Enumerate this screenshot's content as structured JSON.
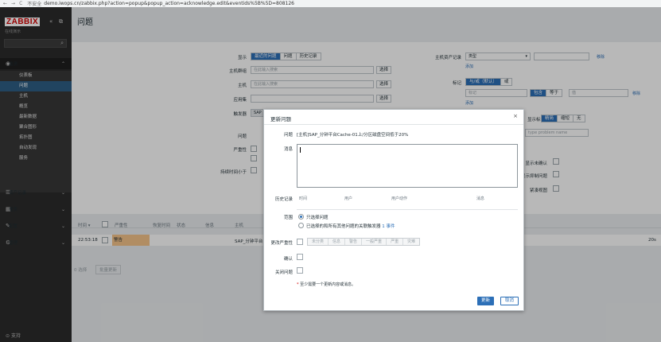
{
  "browser": {
    "back": "←",
    "forward": "→",
    "reload": "C",
    "security": "不安全",
    "url": "demo.iwops.cn/zabbix.php?action=popup&popup_action=acknowledge.edit&eventids%5B%5D=808126"
  },
  "sidebar": {
    "logo": "ZABBIX",
    "subtitle": "在线演示",
    "monitoring": "监测",
    "sub_items": [
      "仪表板",
      "问题",
      "主机",
      "概览",
      "最新数据",
      "聚合图形",
      "拓扑图",
      "自动发现",
      "服务"
    ],
    "inventory": "资产记录",
    "reports": "报表",
    "config": "配置",
    "admin": "管理",
    "support": "支持"
  },
  "page": {
    "title": "问题"
  },
  "filter": {
    "show": "显示",
    "show_opts": [
      "最近的问题",
      "问题",
      "历史记录"
    ],
    "host_groups": "主机群组",
    "host_groups_ph": "在此输入搜索",
    "hosts": "主机",
    "hosts_ph": "在此输入搜索",
    "application": "应用集",
    "triggers": "触发器",
    "triggers_val": "SAP",
    "problem": "问题",
    "severity": "严重性",
    "age_less": "持续时间小于",
    "select": "选择",
    "inventory": "主机资产记录",
    "inventory_val": "类型",
    "remove": "移除",
    "add": "添加",
    "tags": "标记",
    "tags_opts": [
      "与/或（默认）",
      "或"
    ],
    "tag_ph": "标记",
    "tag_op": [
      "包含",
      "等于"
    ],
    "tag_val_ph": "值",
    "show_tags": "显示标记",
    "show_tags_opts": [
      "精简",
      "缩短",
      "无"
    ],
    "tag_ph2": "标记",
    "tag_ph3": "问题名称",
    "problem_name_ph": "type problem name",
    "show_unack": "显示未确认",
    "show_supp": "显示抑制问题",
    "compact": "紧凑视图"
  },
  "table": {
    "headers": [
      "时间 ▾",
      "严重性",
      "恢复时间",
      "状态",
      "信息",
      "主机"
    ],
    "row": {
      "time": "22:53:18",
      "severity": "警告",
      "host": "SAP_分钟平台",
      "duration": "20s",
      "pager": "0 选择",
      "mass": "批量更新"
    }
  },
  "dialog": {
    "title": "更新问题",
    "close": "×",
    "problem_label": "问题",
    "problem_text": "[主机]SAP_分钟平台Cache-01上/分区磁盘空间低于20%",
    "message_label": "消息",
    "history_label": "历史记录",
    "history_cols": [
      "时间",
      "用户",
      "用户动作",
      "消息"
    ],
    "scope_label": "范围",
    "scope_opt1": "只选择问题",
    "scope_opt2": "已选择的和所有其他问题的关联触发器",
    "scope_count": "1 事件",
    "change_sev": "更改严重性",
    "sev_opts": [
      "未分类",
      "信息",
      "警告",
      "一般严重",
      "严重",
      "灾难"
    ],
    "ack_label": "确认",
    "close_label": "关闭问题",
    "note_star": "*",
    "note": "至少需要一个更新内容或消息。",
    "update": "更新",
    "cancel": "取消"
  }
}
